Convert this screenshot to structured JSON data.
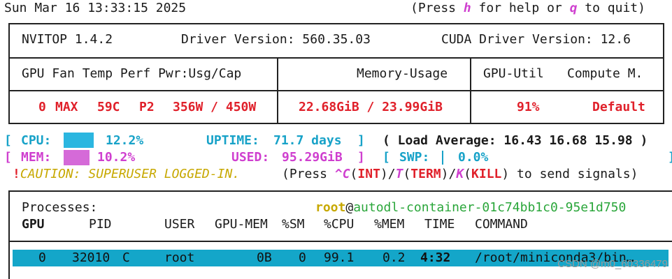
{
  "header": {
    "datetime": "Sun Mar 16 13:33:15 2025",
    "help_prefix": "(Press ",
    "help_key": "h",
    "help_mid": " for help or ",
    "quit_key": "q",
    "help_suffix": " to quit)"
  },
  "gpu_panel": {
    "app_version": "NVITOP 1.4.2",
    "driver_version": "Driver Version: 560.35.03",
    "cuda_version": "CUDA Driver Version: 12.6",
    "col_gpu_fan_temp_perf_pwr": "GPU Fan Temp Perf Pwr:Usg/Cap",
    "col_memory": "Memory-Usage",
    "col_util": "GPU-Util",
    "col_compute": "Compute M.",
    "row": {
      "gpu_id": "0",
      "fan": "MAX",
      "temp": "59C",
      "perf": "P2",
      "power": "356W / 450W",
      "memory": "22.68GiB / 23.99GiB",
      "util": "91%",
      "compute_mode": "Default"
    },
    "status_color": "#e0202a"
  },
  "host": {
    "cpu_label": "CPU:",
    "cpu_percent": "12.2%",
    "uptime_label": "UPTIME:",
    "uptime_value": "71.7 days",
    "load_avg": "( Load Average: 16.43 16.68 15.98 )",
    "mem_label": "MEM:",
    "mem_percent": "10.2%",
    "used_label": "USED:",
    "used_value": "95.29GiB",
    "swp_label": "SWP:",
    "swp_value": "0.0%",
    "cpu_bar_color": "#2bb6e0",
    "mem_bar_color": "#d56ad8"
  },
  "caution": {
    "bang": "!",
    "text": "CAUTION: SUPERUSER LOGGED-IN.",
    "press": "(Press ",
    "ctrl_c": "^C",
    "int": "INT",
    "t_key": "T",
    "term": "TERM",
    "k_key": "K",
    "kill": "KILL",
    "suffix": " to send signals)"
  },
  "processes": {
    "title": "Processes:",
    "user": "root",
    "at": "@",
    "host": "autodl-container-01c74bb1c0-95e1d750",
    "headers": [
      "GPU",
      "PID",
      "USER",
      "GPU-MEM",
      "%SM",
      "%CPU",
      "%MEM",
      "TIME",
      "COMMAND"
    ],
    "row": {
      "gpu": "0",
      "pid": "32010",
      "type": "C",
      "user": "root",
      "gpu_mem": "0B",
      "sm": "0",
      "cpu": "99.1",
      "mem": "0.2",
      "time": "4:32",
      "command": "/root/miniconda3/bin…"
    },
    "row_color": "#14a6c9"
  },
  "watermark": "CSDN @m0_60336479"
}
